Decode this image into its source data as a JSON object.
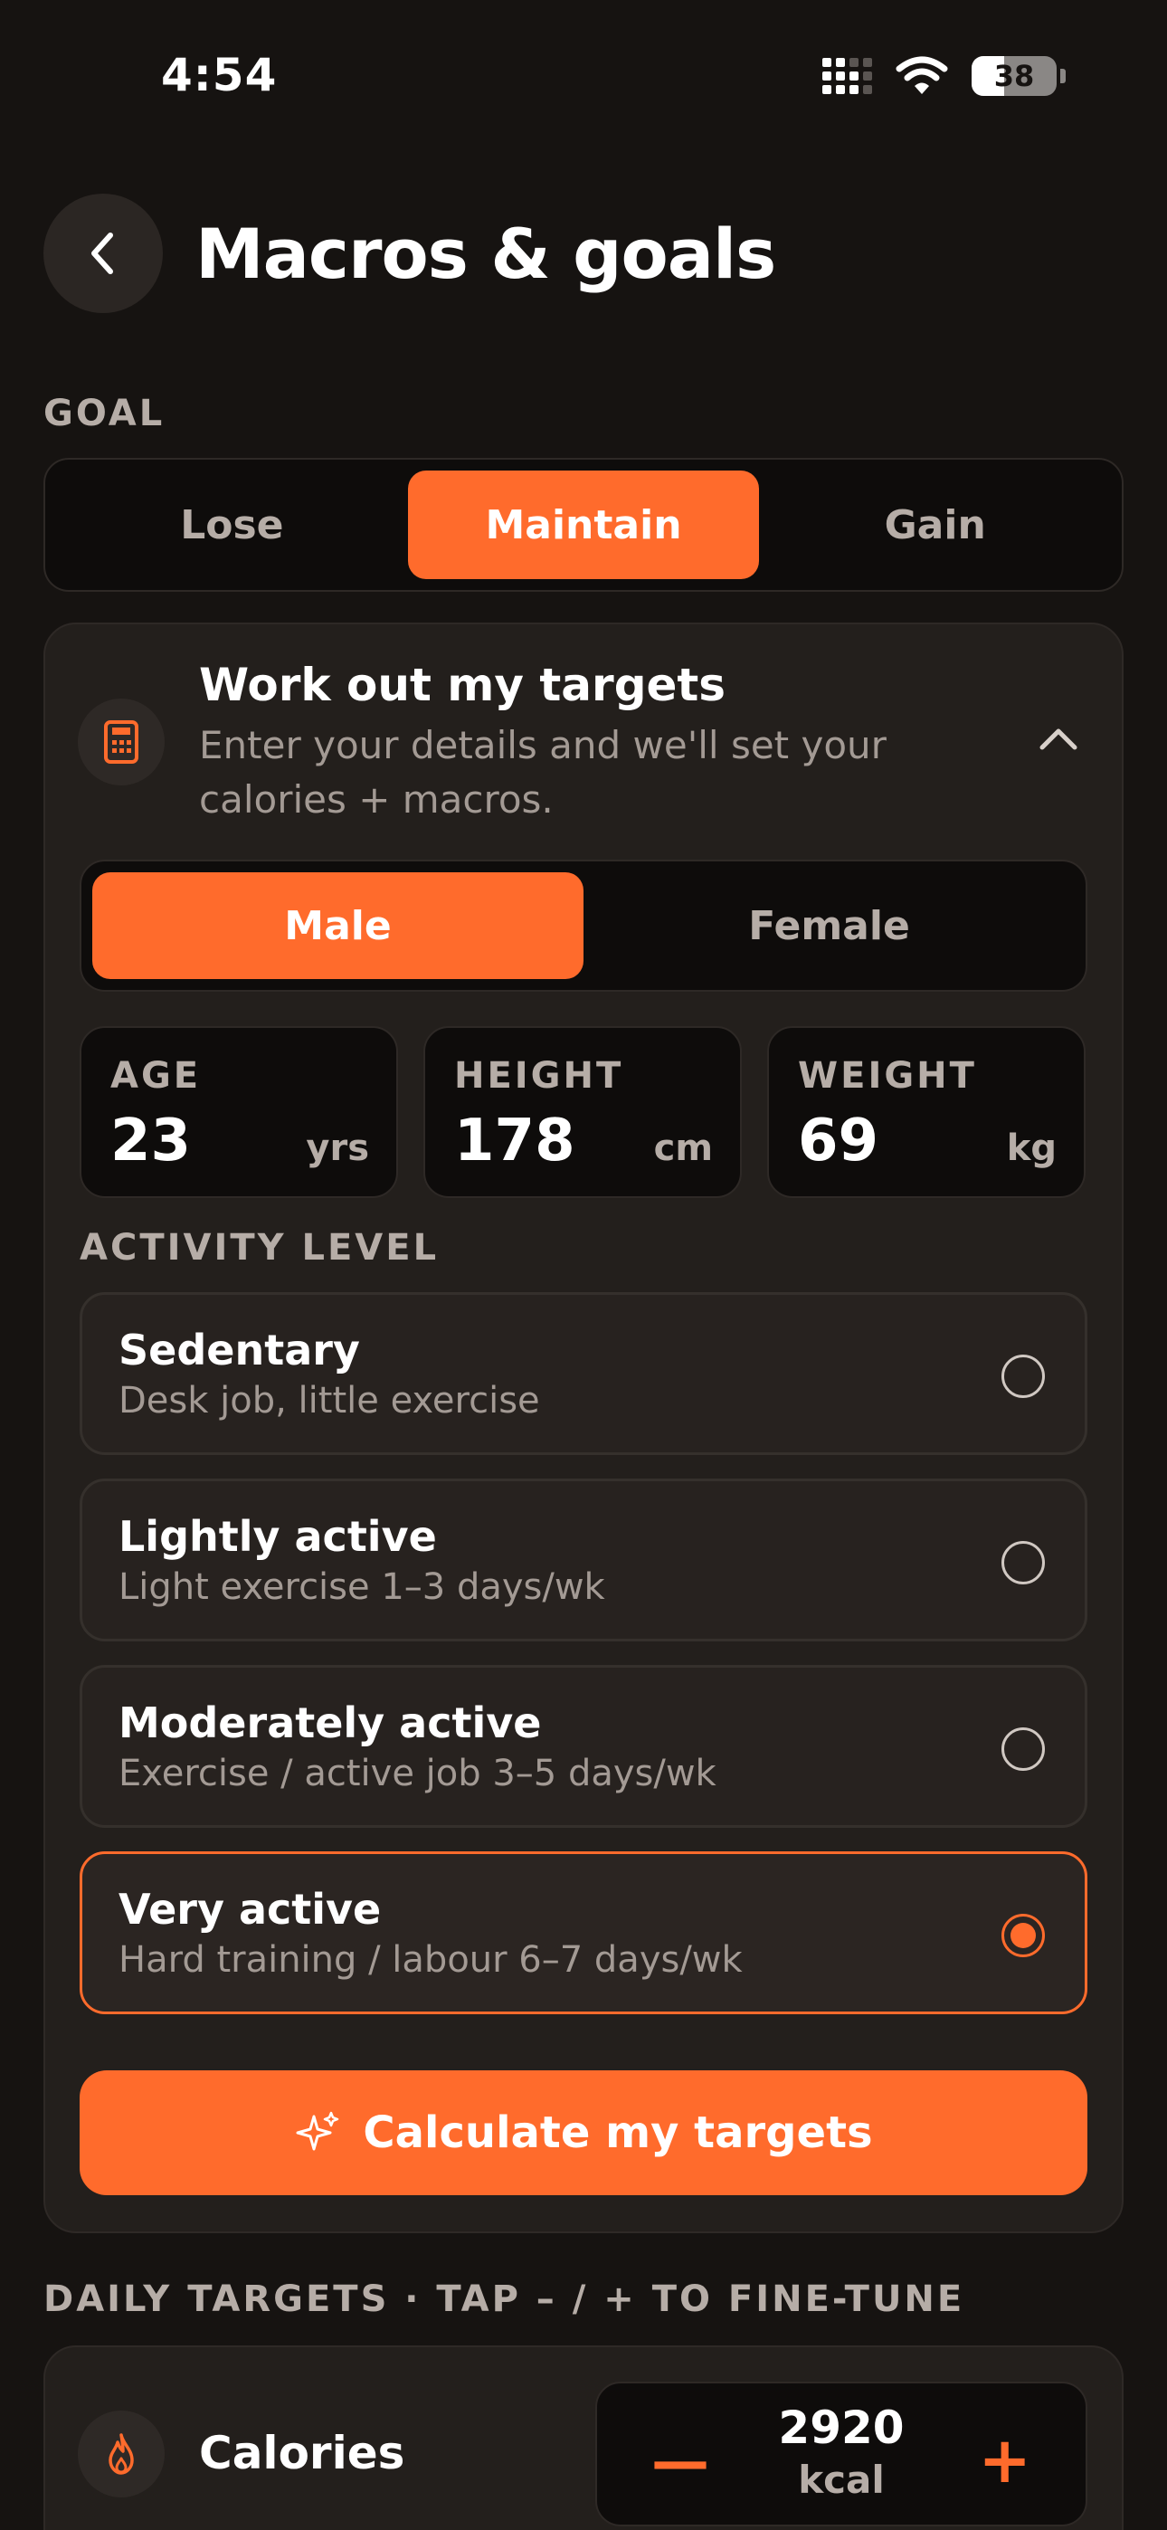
{
  "status_bar": {
    "time": "4:54",
    "battery": "38"
  },
  "header": {
    "title": "Macros & goals"
  },
  "goal": {
    "label": "GOAL",
    "options": [
      "Lose",
      "Maintain",
      "Gain"
    ],
    "selected": "Maintain"
  },
  "targets_card": {
    "title": "Work out my targets",
    "subtitle": "Enter your details and we'll set your calories + macros.",
    "sex": {
      "options": [
        "Male",
        "Female"
      ],
      "selected": "Male"
    },
    "stats": {
      "age": {
        "label": "AGE",
        "value": "23",
        "unit": "yrs"
      },
      "height": {
        "label": "HEIGHT",
        "value": "178",
        "unit": "cm"
      },
      "weight": {
        "label": "WEIGHT",
        "value": "69",
        "unit": "kg"
      }
    },
    "activity_label": "ACTIVITY LEVEL",
    "activity": [
      {
        "title": "Sedentary",
        "desc": "Desk job, little exercise"
      },
      {
        "title": "Lightly active",
        "desc": "Light exercise 1–3 days/wk"
      },
      {
        "title": "Moderately active",
        "desc": "Exercise / active job 3–5 days/wk"
      },
      {
        "title": "Very active",
        "desc": "Hard training / labour 6–7 days/wk"
      }
    ],
    "activity_selected": "Very active",
    "calculate_label": "Calculate my targets"
  },
  "daily_targets": {
    "label": "DAILY TARGETS · TAP – / + TO FINE-TUNE",
    "calories": {
      "label": "Calories",
      "value": "2920",
      "unit": "kcal"
    }
  },
  "colors": {
    "accent": "#ff6b2c",
    "background": "#161311",
    "card": "#231f1c"
  }
}
